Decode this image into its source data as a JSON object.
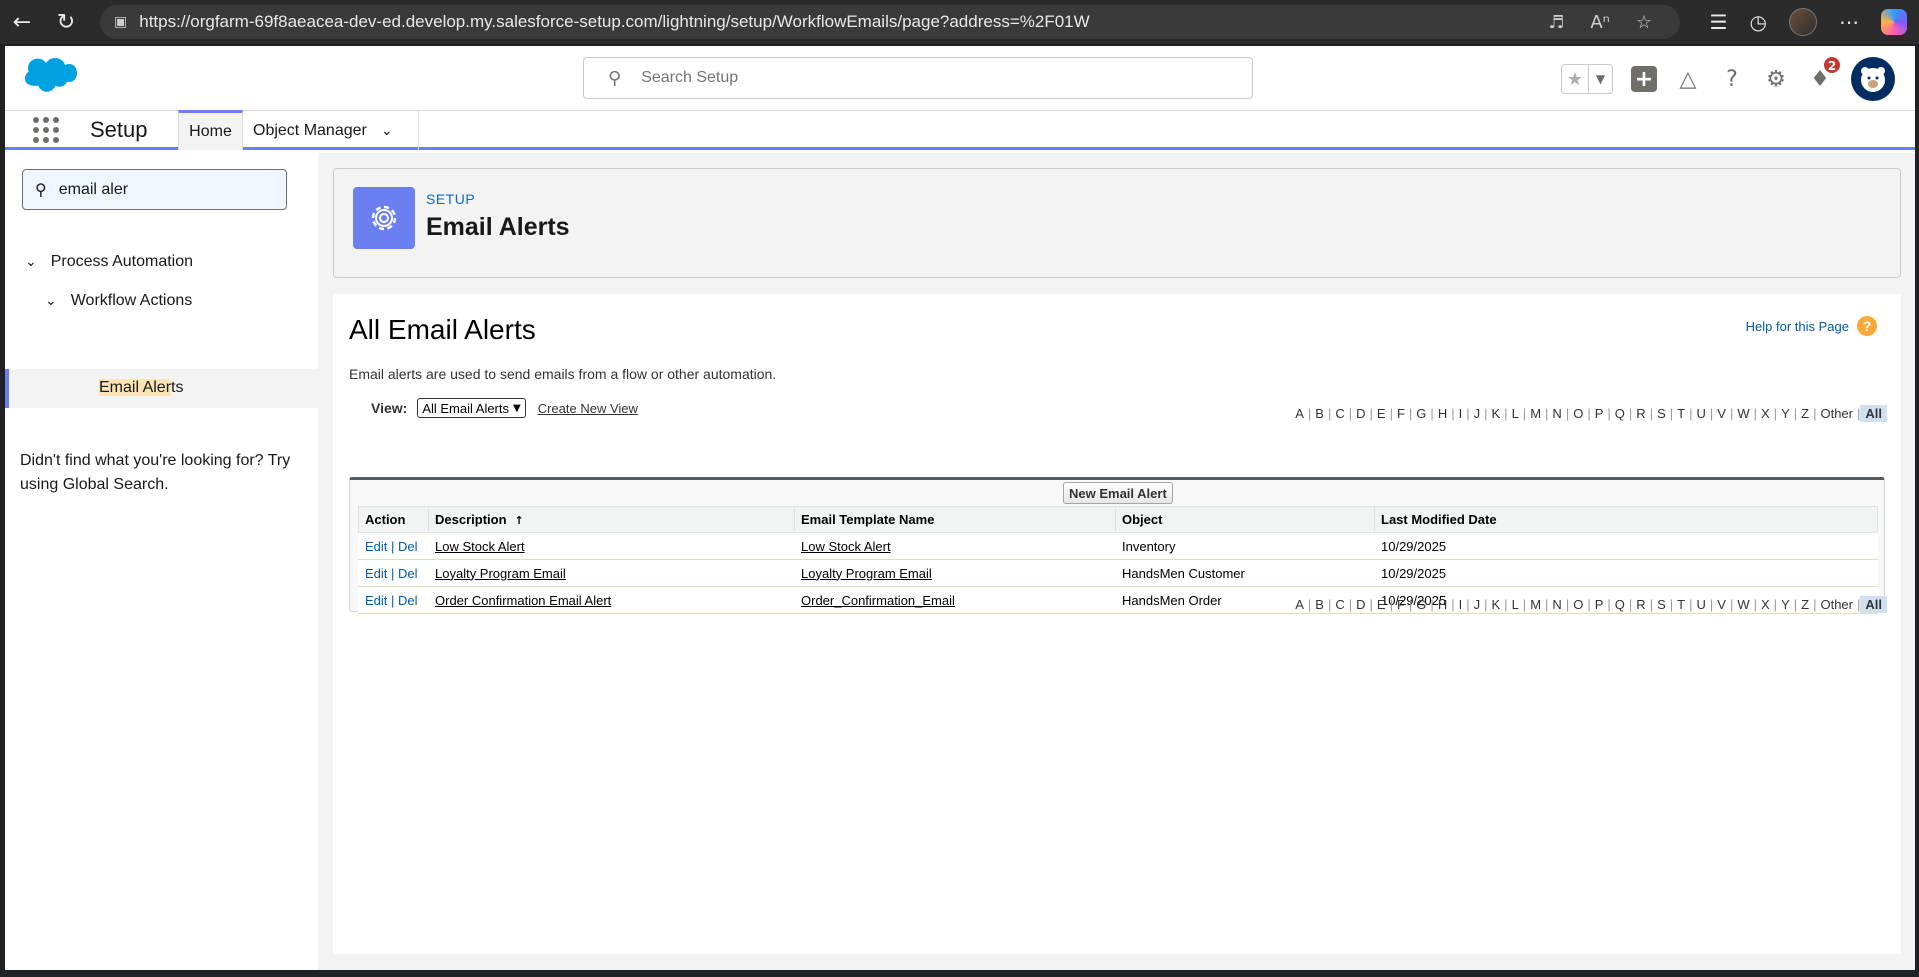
{
  "browser": {
    "url": "https://orgfarm-69f8aeacea-dev-ed.develop.my.salesforce-setup.com/lightning/setup/WorkflowEmails/page?address=%2F01W"
  },
  "header": {
    "search_placeholder": "Search Setup",
    "notification_count": "2"
  },
  "context_bar": {
    "app_name": "Setup",
    "tabs": [
      {
        "label": "Home"
      },
      {
        "label": "Object Manager"
      }
    ]
  },
  "sidebar": {
    "quick_find_value": "email aler",
    "tree": [
      {
        "label": "Process Automation"
      },
      {
        "label": "Workflow Actions"
      }
    ],
    "selected_leaf_highlight": "Email Aler",
    "selected_leaf_rest": "ts",
    "not_found_text": "Didn't find what you're looking for? Try using Global Search."
  },
  "page_header": {
    "label": "SETUP",
    "title": "Email Alerts"
  },
  "content": {
    "list_title": "All Email Alerts",
    "help_link": "Help for this Page",
    "help_icon": "?",
    "description": "Email alerts are used to send emails from a flow or other automation.",
    "view_label": "View:",
    "view_selected": "All Email Alerts",
    "create_view": "Create New View",
    "new_button": "New Email Alert",
    "alphabet": [
      "A",
      "B",
      "C",
      "D",
      "E",
      "F",
      "G",
      "H",
      "I",
      "J",
      "K",
      "L",
      "M",
      "N",
      "O",
      "P",
      "Q",
      "R",
      "S",
      "T",
      "U",
      "V",
      "W",
      "X",
      "Y",
      "Z",
      "Other",
      "All"
    ],
    "columns": [
      "Action",
      "Description",
      "Email Template Name",
      "Object",
      "Last Modified Date"
    ],
    "rows": [
      {
        "edit": "Edit",
        "sep": "|",
        "del": "Del",
        "description": "Low Stock Alert",
        "template": "Low Stock Alert",
        "object": "Inventory",
        "modified": "10/29/2025"
      },
      {
        "edit": "Edit",
        "sep": "|",
        "del": "Del",
        "description": "Loyalty Program Email",
        "template": "Loyalty Program Email",
        "object": "HandsMen Customer",
        "modified": "10/29/2025"
      },
      {
        "edit": "Edit",
        "sep": "|",
        "del": "Del",
        "description": "Order Confirmation Email Alert",
        "template": "Order_Confirmation_Email",
        "object": "HandsMen Order",
        "modified": "10/29/2025"
      }
    ]
  },
  "colors": {
    "brand_blue": "#00a1e0",
    "accent_purple": "#6c7ff0",
    "link_blue": "#015ba7"
  }
}
